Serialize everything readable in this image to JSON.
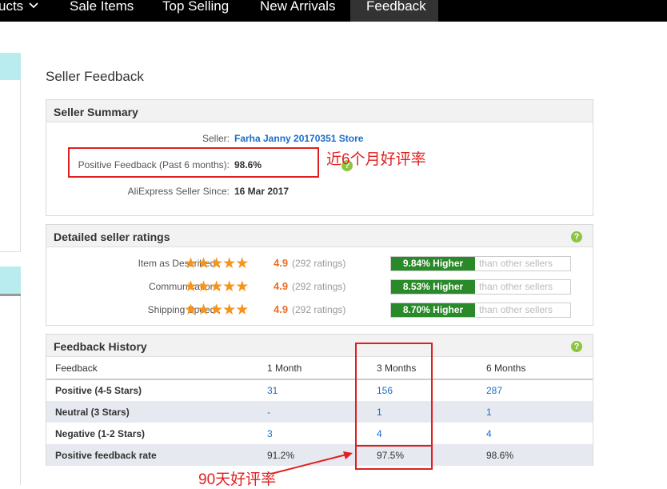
{
  "nav": {
    "items": [
      {
        "label": "ucts"
      },
      {
        "label": "Sale Items"
      },
      {
        "label": "Top Selling"
      },
      {
        "label": "New Arrivals"
      },
      {
        "label": "Feedback"
      }
    ]
  },
  "page": {
    "title": "Seller Feedback"
  },
  "summary": {
    "heading": "Seller Summary",
    "seller_label": "Seller:",
    "seller_name": "Farha Janny 20170351 Store",
    "positive_label": "Positive Feedback (Past 6 months):",
    "positive_value": "98.6%",
    "since_label": "AliExpress Seller Since:",
    "since_value": "16 Mar 2017"
  },
  "ratings": {
    "heading": "Detailed seller ratings",
    "rows": [
      {
        "label": "Item as Described :",
        "stars": 5,
        "score": "4.9",
        "count": "(292 ratings)",
        "pct": "9.84% Higher",
        "cmp": "than other sellers"
      },
      {
        "label": "Communication :",
        "stars": 5,
        "score": "4.9",
        "count": "(292 ratings)",
        "pct": "8.53% Higher",
        "cmp": "than other sellers"
      },
      {
        "label": "Shipping Speed :",
        "stars": 5,
        "score": "4.9",
        "count": "(292 ratings)",
        "pct": "8.70% Higher",
        "cmp": "than other sellers"
      }
    ]
  },
  "history": {
    "heading": "Feedback History",
    "headers": [
      "Feedback",
      "1 Month",
      "3 Months",
      "6 Months"
    ],
    "rows": [
      {
        "label": "Positive (4-5 Stars)",
        "m1": "31",
        "m3": "156",
        "m6": "287"
      },
      {
        "label": "Neutral (3 Stars)",
        "m1": "-",
        "m3": "1",
        "m6": "1"
      },
      {
        "label": "Negative (1-2 Stars)",
        "m1": "3",
        "m3": "4",
        "m6": "4"
      },
      {
        "label": "Positive feedback rate",
        "m1": "91.2%",
        "m3": "97.5%",
        "m6": "98.6%"
      }
    ]
  },
  "annotations": {
    "six_month": "近6个月好评率",
    "ninety_day": "90天好评率"
  },
  "help_glyph": "?",
  "star_glyph": "★",
  "colors": {
    "accent": "#f7941d",
    "link": "#1a6ec6",
    "higher": "#2a8a2a",
    "annotation": "#e02020"
  }
}
